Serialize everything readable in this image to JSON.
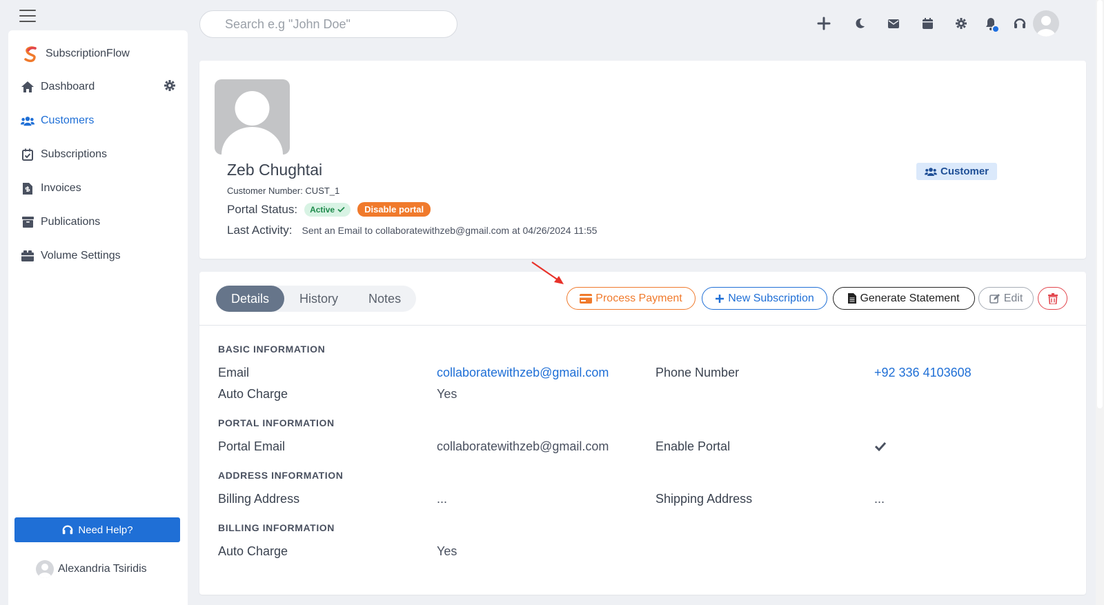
{
  "search": {
    "placeholder": "Search e.g \"John Doe\""
  },
  "sidebar": {
    "brand": "SubscriptionFlow",
    "items": [
      {
        "label": "Dashboard",
        "icon": "home-icon"
      },
      {
        "label": "Customers",
        "icon": "users-icon"
      },
      {
        "label": "Subscriptions",
        "icon": "calendar-check-icon"
      },
      {
        "label": "Invoices",
        "icon": "invoice-icon"
      },
      {
        "label": "Publications",
        "icon": "archive-icon"
      },
      {
        "label": "Volume Settings",
        "icon": "boxes-icon"
      }
    ],
    "help_label": "Need Help?",
    "user_name": "Alexandria Tsiridis"
  },
  "profile": {
    "name": "Zeb Chughtai",
    "customer_number": "Customer Number: CUST_1",
    "portal_status_label": "Portal Status:",
    "portal_status": "Active",
    "disable_label": "Disable portal",
    "last_activity_label": "Last Activity:",
    "last_activity": "Sent an Email to collaboratewithzeb@gmail.com at 04/26/2024 11:55",
    "role": "Customer"
  },
  "tabs": [
    "Details",
    "History",
    "Notes"
  ],
  "actions": {
    "process_payment": "Process Payment",
    "new_subscription": "New Subscription",
    "generate_statement": "Generate Statement",
    "edit": "Edit"
  },
  "details": {
    "basic_title": "BASIC INFORMATION",
    "email_label": "Email",
    "email": "collaboratewithzeb@gmail.com",
    "phone_label": "Phone Number",
    "phone": "+92 336 4103608",
    "auto_charge_label": "Auto Charge",
    "auto_charge": "Yes",
    "portal_title": "PORTAL INFORMATION",
    "portal_email_label": "Portal Email",
    "portal_email": "collaboratewithzeb@gmail.com",
    "enable_portal_label": "Enable Portal",
    "address_title": "ADDRESS INFORMATION",
    "billing_address_label": "Billing Address",
    "billing_address": "...",
    "shipping_address_label": "Shipping Address",
    "shipping_address": "...",
    "billing_title": "BILLING INFORMATION",
    "billing_auto_charge_label": "Auto Charge",
    "billing_auto_charge": "Yes"
  },
  "colors": {
    "primary": "#1f6fd6",
    "accent_orange": "#f07a2c",
    "danger": "#e2444c",
    "active_green": "#1f8a4c"
  }
}
